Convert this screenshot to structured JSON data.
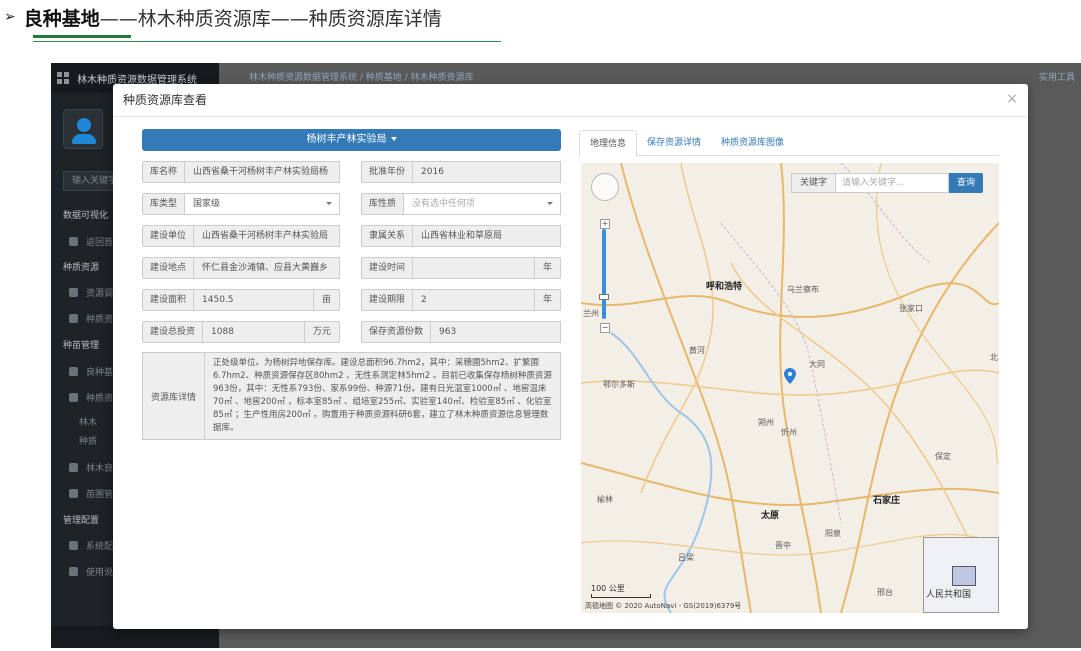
{
  "slide": {
    "arrow": "➢",
    "title_bold": "良种基地",
    "title_rest": "——林木种质资源库——种质资源库详情"
  },
  "app": {
    "brand": "林木种质资源数据管理系统",
    "breadcrumb": "林木种质资源数据管理系统  /  种质基地  /  林木种质资源库",
    "tools": "实用工具",
    "search_placeholder": "输入关键字",
    "sidebar": [
      {
        "type": "section",
        "label": "数据可视化"
      },
      {
        "type": "item",
        "label": "返回首"
      },
      {
        "type": "section",
        "label": "种质资源"
      },
      {
        "type": "item",
        "label": "资源调"
      },
      {
        "type": "item",
        "label": "种质资"
      },
      {
        "type": "section",
        "label": "种苗管理"
      },
      {
        "type": "item",
        "label": "良种基"
      },
      {
        "type": "item",
        "label": "种质资"
      },
      {
        "type": "sub",
        "label": "林木"
      },
      {
        "type": "sub",
        "label": "种质"
      },
      {
        "type": "item",
        "label": "林木良"
      },
      {
        "type": "item",
        "label": "苗圃管"
      },
      {
        "type": "section",
        "label": "管理配置"
      },
      {
        "type": "item",
        "label": "系统配"
      },
      {
        "type": "item",
        "label": "使用说"
      }
    ]
  },
  "modal": {
    "title": "种质资源库查看",
    "close": "×",
    "base_select": "杨树丰产林实验局",
    "fields": {
      "name": {
        "label": "库名称",
        "value": "山西省桑干河杨树丰产林实验局杨"
      },
      "year": {
        "label": "批准年份",
        "value": "2016"
      },
      "type": {
        "label": "库类型",
        "value": "国家级"
      },
      "nature": {
        "label": "库性质",
        "placeholder": "没有选中任何项"
      },
      "unit": {
        "label": "建设单位",
        "value": "山西省桑干河杨树丰产林实验局"
      },
      "affil": {
        "label": "隶属关系",
        "value": "山西省林业和草原局"
      },
      "place": {
        "label": "建设地点",
        "value": "怀仁县金沙滩镇、应县大黄巍乡"
      },
      "time": {
        "label": "建设时间",
        "value": "",
        "unit": "年"
      },
      "area": {
        "label": "建设面积",
        "value": "1450.5",
        "unit": "亩"
      },
      "term": {
        "label": "建设期限",
        "value": "2",
        "unit": "年"
      },
      "invest": {
        "label": "建设总投资",
        "value": "1088",
        "unit": "万元"
      },
      "count": {
        "label": "保存资源份数",
        "value": "963"
      }
    },
    "detail": {
      "label": "资源库详情",
      "text": "正处级单位。为杨树异地保存库。建设总面积96.7hm2，其中：采穗圃5hm2、扩繁圃6.7hm2、种质资源保存区80hm2 、无性系测定林5hm2 。目前已收集保存杨树种质资源963份，其中：无性系793份、家系99份、种源71份。建有日光温室1000㎡ 、地窖温床70㎡ 、地窖200㎡ ，标本室85㎡ 、组培室255㎡、实验室140㎡、检验室85㎡ 、化验室85㎡ ；生产性用房200㎡ 。购置用于种质资源科研6套，建立了林木种质资源信息管理数据库。"
    },
    "tabs": [
      "地理信息",
      "保存资源详情",
      "种质资源库图像"
    ],
    "map": {
      "keyword_label": "关键字",
      "keyword_placeholder": "请输入关键字...",
      "search_button": "查询",
      "cities": [
        "呼和浩特",
        "太原",
        "石家庄"
      ],
      "places": [
        "乌兰察布",
        "张家口",
        "大同",
        "朔州",
        "鄂尔多斯",
        "保定",
        "榆林",
        "晋中",
        "阳泉",
        "吕梁",
        "邢台",
        "兰州",
        "忻州",
        "黄河",
        "北"
      ],
      "scale": "100 公里",
      "copyright": "高德地图 © 2020 AutoNavi - GS(2019)6379号",
      "overview_text": "人民共和国"
    }
  }
}
